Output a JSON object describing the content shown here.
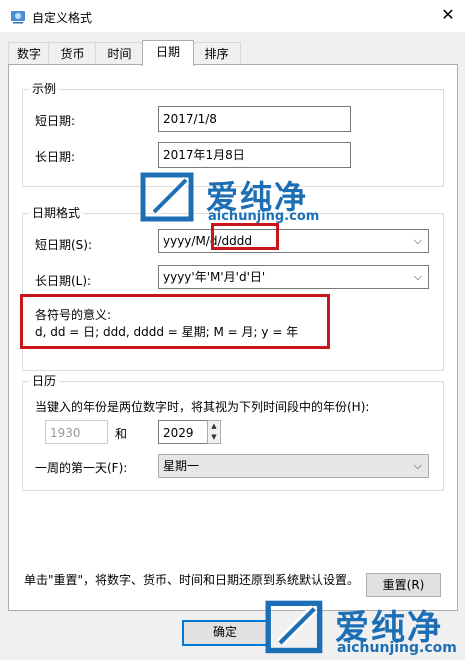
{
  "window": {
    "title": "自定义格式",
    "close_glyph": "✕"
  },
  "tabs": [
    "数字",
    "货币",
    "时间",
    "日期",
    "排序"
  ],
  "active_tab": "日期",
  "example": {
    "group_label": "示例",
    "short_label": "短日期:",
    "short_value": "2017/1/8",
    "long_label": "长日期:",
    "long_value": "2017年1月8日"
  },
  "date_formats": {
    "group_label": "日期格式",
    "short_label": "短日期(S):",
    "short_value": "yyyy/M/d/dddd",
    "long_label": "长日期(L):",
    "long_value": "yyyy'年'M'月'd'日'",
    "legend_title": "各符号的意义:",
    "legend_text": "d, dd = 日;  ddd, dddd = 星期;  M = 月;  y = 年"
  },
  "calendar": {
    "group_label": "日历",
    "two_digit_text": "当键入的年份是两位数字时，将其视为下列时间段中的年份(H):",
    "year_from": "1930",
    "and_label": "和",
    "year_to": "2029",
    "first_day_label": "一周的第一天(F):",
    "first_day_value": "星期一"
  },
  "reset": {
    "text": "单击\"重置\"，将数字、货币、时间和日期还原到系统默认设置。",
    "button_label": "重置(R)"
  },
  "footer": {
    "ok_label": "确定"
  },
  "watermark": {
    "text": "爱纯净",
    "url": "aichunjing.com"
  },
  "colors": {
    "highlight": "#c8151b",
    "watermark": "#1c6fb5",
    "focus": "#0078d7"
  },
  "icons": {
    "dropdown": "chevron-down-icon",
    "spin_up": "▲",
    "spin_down": "▼",
    "chevron": "⌵"
  }
}
